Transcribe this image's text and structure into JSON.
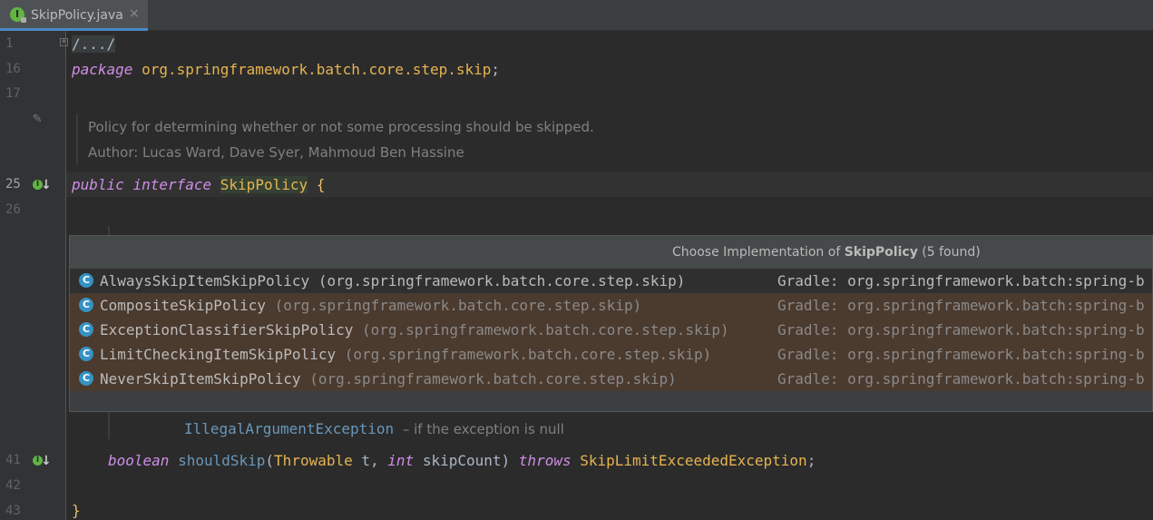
{
  "tab": {
    "icon_letter": "I",
    "title": "SkipPolicy.java",
    "close": "×"
  },
  "gutter": {
    "lines": [
      "1",
      "16",
      "17",
      "25",
      "26",
      "41",
      "42",
      "43"
    ],
    "pencil": "✎"
  },
  "code": {
    "fold_text": "/.../",
    "line16_kw": "package",
    "line16_pkg": "org.springframework.batch.core.step.skip",
    "line16_semicolon": ";",
    "doc_line1": "Policy for determining whether or not some processing should be skipped.",
    "doc_line2": "Author: Lucas Ward, Dave Syer, Mahmoud Ben Hassine",
    "line25_kw1": "public",
    "line25_kw2": "interface",
    "line25_type": "SkipPolicy",
    "line25_brace": "{",
    "throws_doc_exception": "IllegalArgumentException",
    "throws_doc_text": "– if the exception is null",
    "line41_kw": "boolean",
    "line41_method": "shouldSkip",
    "line41_open": "(",
    "line41_type1": "Throwable",
    "line41_param1": " t, ",
    "line41_kw2": "int",
    "line41_param2": " skipCount)",
    "line41_throws": "throws",
    "line41_type2": "SkipLimitExceededException",
    "line41_semicolon": ";",
    "line43_brace": "}"
  },
  "popup": {
    "title_prefix": "Choose Implementation of ",
    "title_type": "SkipPolicy",
    "title_suffix": " (5 found)",
    "items": [
      {
        "icon": "C",
        "name": "AlwaysSkipItemSkipPolicy",
        "pkg": "(org.springframework.batch.core.step.skip)",
        "location": "Gradle: org.springframework.batch:spring-b"
      },
      {
        "icon": "C",
        "name": "CompositeSkipPolicy",
        "pkg": "(org.springframework.batch.core.step.skip)",
        "location": "Gradle: org.springframework.batch:spring-b"
      },
      {
        "icon": "C",
        "name": "ExceptionClassifierSkipPolicy",
        "pkg": "(org.springframework.batch.core.step.skip)",
        "location": "Gradle: org.springframework.batch:spring-b"
      },
      {
        "icon": "C",
        "name": "LimitCheckingItemSkipPolicy",
        "pkg": "(org.springframework.batch.core.step.skip)",
        "location": "Gradle: org.springframework.batch:spring-b"
      },
      {
        "icon": "C",
        "name": "NeverSkipItemSkipPolicy",
        "pkg": "(org.springframework.batch.core.step.skip)",
        "location": "Gradle: org.springframework.batch:spring-b"
      }
    ]
  },
  "colors": {
    "accent": "#4a88c7",
    "editor_bg": "#2b2b2b",
    "popup_row_bg": "#4b3a2e"
  }
}
